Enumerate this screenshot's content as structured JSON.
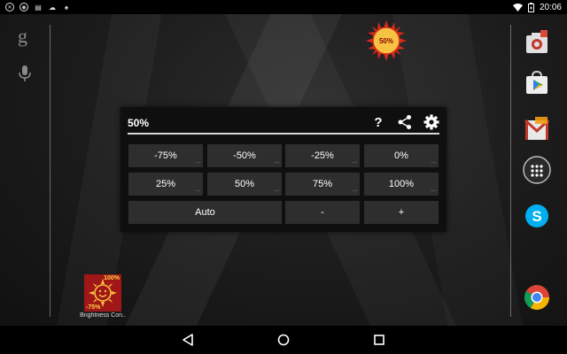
{
  "status_bar": {
    "time": "20:06",
    "left_icons": [
      "notification-icon",
      "sync-icon",
      "gallery-icon",
      "cloud-icon",
      "android-icon"
    ],
    "right_icons": [
      "wifi-icon",
      "battery-charging-icon"
    ]
  },
  "sun_widget": {
    "label": "50%"
  },
  "dialog": {
    "title": "50%",
    "actions": {
      "help": "?"
    },
    "buttons_row1": [
      "-75%",
      "-50%",
      "-25%",
      "0%"
    ],
    "buttons_row2": [
      "25%",
      "50%",
      "75%",
      "100%"
    ],
    "buttons_row3": [
      "Auto",
      "-",
      "+"
    ],
    "more_dots": "..."
  },
  "app_icon": {
    "pct_top": "100%",
    "pct_bottom": "-75%",
    "label": "Brightness Con.."
  },
  "left_rail": {
    "google_glyph": "g"
  },
  "colors": {
    "dialog_bg": "#0f0f0f",
    "button_bg": "#2e2e2e",
    "app_icon_bg": "#a11616",
    "sun_yellow": "#f5c242",
    "sun_red": "#d82a1c"
  }
}
